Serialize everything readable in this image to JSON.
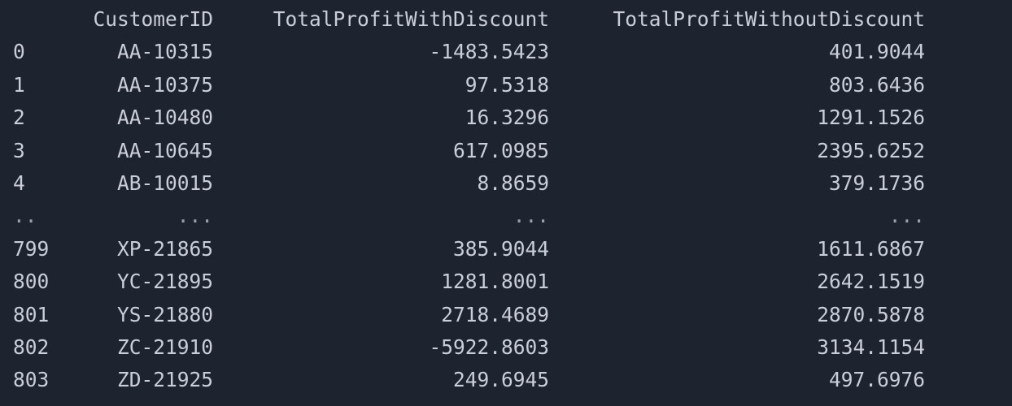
{
  "table": {
    "columns": [
      "",
      "CustomerID",
      "TotalProfitWithDiscount",
      "TotalProfitWithoutDiscount"
    ],
    "rows": [
      [
        "0",
        "AA-10315",
        "-1483.5423",
        "401.9044"
      ],
      [
        "1",
        "AA-10375",
        "97.5318",
        "803.6436"
      ],
      [
        "2",
        "AA-10480",
        "16.3296",
        "1291.1526"
      ],
      [
        "3",
        "AA-10645",
        "617.0985",
        "2395.6252"
      ],
      [
        "4",
        "AB-10015",
        "8.8659",
        "379.1736"
      ],
      [
        "..",
        "...",
        "...",
        "..."
      ],
      [
        "799",
        "XP-21865",
        "385.9044",
        "1611.6867"
      ],
      [
        "800",
        "YC-21895",
        "1281.8001",
        "2642.1519"
      ],
      [
        "801",
        "YS-21880",
        "2718.4689",
        "2870.5878"
      ],
      [
        "802",
        "ZC-21910",
        "-5922.8603",
        "3134.1154"
      ],
      [
        "803",
        "ZD-21925",
        "249.6945",
        "497.6976"
      ]
    ]
  }
}
